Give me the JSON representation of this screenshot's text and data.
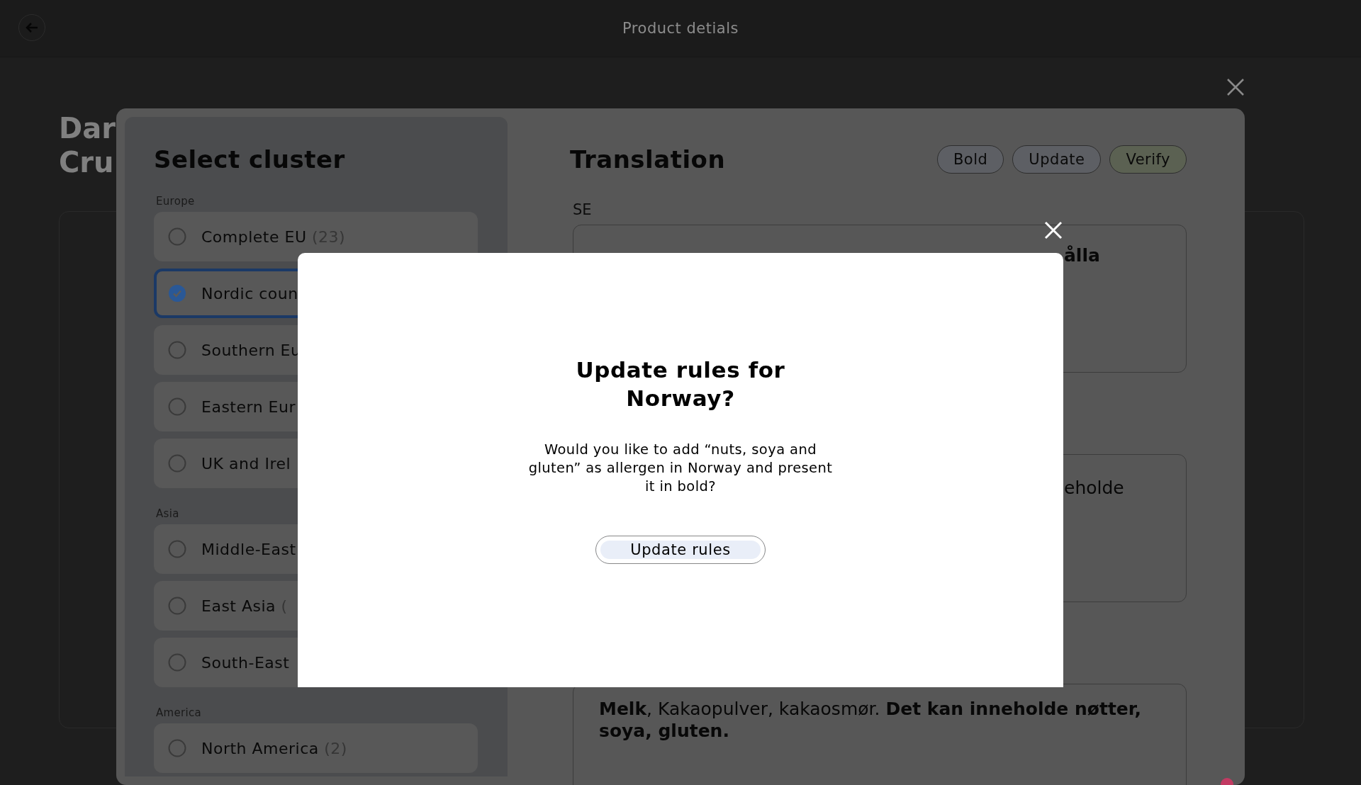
{
  "app_bar": {
    "title": "Product detials"
  },
  "page": {
    "heading_lines": [
      "Dar",
      "Cru"
    ]
  },
  "cluster_panel": {
    "title": "Select cluster",
    "groups": [
      {
        "label": "Europe",
        "items": [
          {
            "name": "Complete EU",
            "count": "(23)",
            "selected": false
          },
          {
            "name": "Nordic coun",
            "selected": true
          },
          {
            "name": "Southern Eu",
            "selected": false
          },
          {
            "name": "Eastern Eur",
            "selected": false
          },
          {
            "name": "UK and Irel",
            "selected": false
          }
        ]
      },
      {
        "label": "Asia",
        "items": [
          {
            "name": "Middle-East",
            "selected": false
          },
          {
            "name": "East Asia",
            "count": "(",
            "selected": false
          },
          {
            "name": "South-East",
            "selected": false
          }
        ]
      },
      {
        "label": "America",
        "items": [
          {
            "name": "North America",
            "count": "(2)",
            "selected": false
          }
        ]
      }
    ]
  },
  "translation": {
    "title": "Translation",
    "buttons": [
      {
        "label": "Bold",
        "kind": "plain"
      },
      {
        "label": "Update",
        "kind": "plain"
      },
      {
        "label": "Verify",
        "kind": "primary"
      }
    ],
    "fields": [
      {
        "label": "SE",
        "kind": "covered",
        "text": "**ålla**"
      },
      {
        "kind": "covered",
        "text": "eholde"
      },
      {
        "kind": "full",
        "text": "**Melk**, Kakaopulver, kakaosmør. **Det kan inneholde nøtter, soya, gluten.**"
      }
    ]
  },
  "dialog": {
    "title": "Update rules for Norway?",
    "message": "Would you like to add “nuts, soya and gluten” as allergen in Norway and present it in bold?",
    "button": "Update rules"
  }
}
